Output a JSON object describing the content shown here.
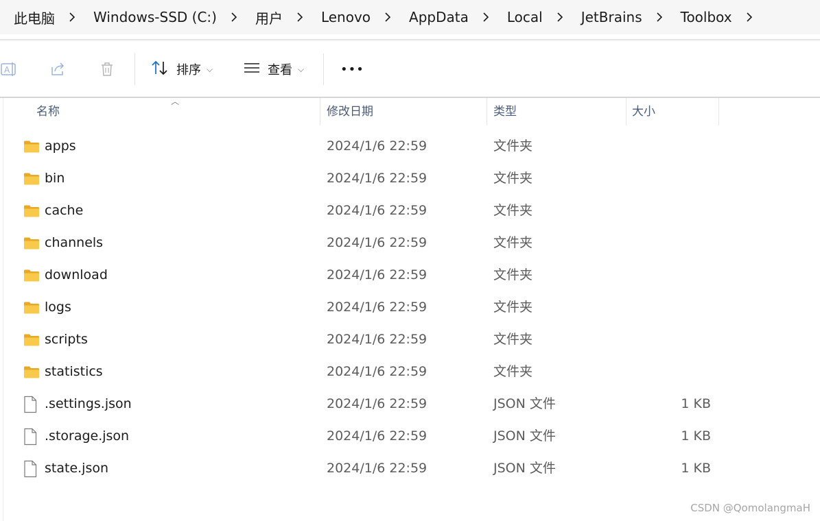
{
  "breadcrumb": {
    "items": [
      {
        "label": "此电脑"
      },
      {
        "label": "Windows-SSD (C:)"
      },
      {
        "label": "用户"
      },
      {
        "label": "Lenovo"
      },
      {
        "label": "AppData"
      },
      {
        "label": "Local"
      },
      {
        "label": "JetBrains"
      },
      {
        "label": "Toolbox"
      }
    ]
  },
  "toolbar": {
    "rename_icon": "rename-icon",
    "share_icon": "share-icon",
    "delete_icon": "trash-icon",
    "sort_label": "排序",
    "view_label": "查看",
    "more_label": "•••"
  },
  "columns": {
    "name": "名称",
    "date": "修改日期",
    "type": "类型",
    "size": "大小"
  },
  "files": [
    {
      "name": "apps",
      "date": "2024/1/6 22:59",
      "type": "文件夹",
      "size": "",
      "kind": "folder"
    },
    {
      "name": "bin",
      "date": "2024/1/6 22:59",
      "type": "文件夹",
      "size": "",
      "kind": "folder"
    },
    {
      "name": "cache",
      "date": "2024/1/6 22:59",
      "type": "文件夹",
      "size": "",
      "kind": "folder"
    },
    {
      "name": "channels",
      "date": "2024/1/6 22:59",
      "type": "文件夹",
      "size": "",
      "kind": "folder"
    },
    {
      "name": "download",
      "date": "2024/1/6 22:59",
      "type": "文件夹",
      "size": "",
      "kind": "folder"
    },
    {
      "name": "logs",
      "date": "2024/1/6 22:59",
      "type": "文件夹",
      "size": "",
      "kind": "folder"
    },
    {
      "name": "scripts",
      "date": "2024/1/6 22:59",
      "type": "文件夹",
      "size": "",
      "kind": "folder"
    },
    {
      "name": "statistics",
      "date": "2024/1/6 22:59",
      "type": "文件夹",
      "size": "",
      "kind": "folder"
    },
    {
      "name": ".settings.json",
      "date": "2024/1/6 22:59",
      "type": "JSON 文件",
      "size": "1 KB",
      "kind": "file"
    },
    {
      "name": ".storage.json",
      "date": "2024/1/6 22:59",
      "type": "JSON 文件",
      "size": "1 KB",
      "kind": "file"
    },
    {
      "name": "state.json",
      "date": "2024/1/6 22:59",
      "type": "JSON 文件",
      "size": "1 KB",
      "kind": "file"
    }
  ],
  "watermark": "CSDN @QomolangmaH",
  "colors": {
    "folder": "#f8c94b",
    "folder_dark": "#e6a92a",
    "accent": "#1b6fc9",
    "header_text": "#4a5c7a"
  }
}
